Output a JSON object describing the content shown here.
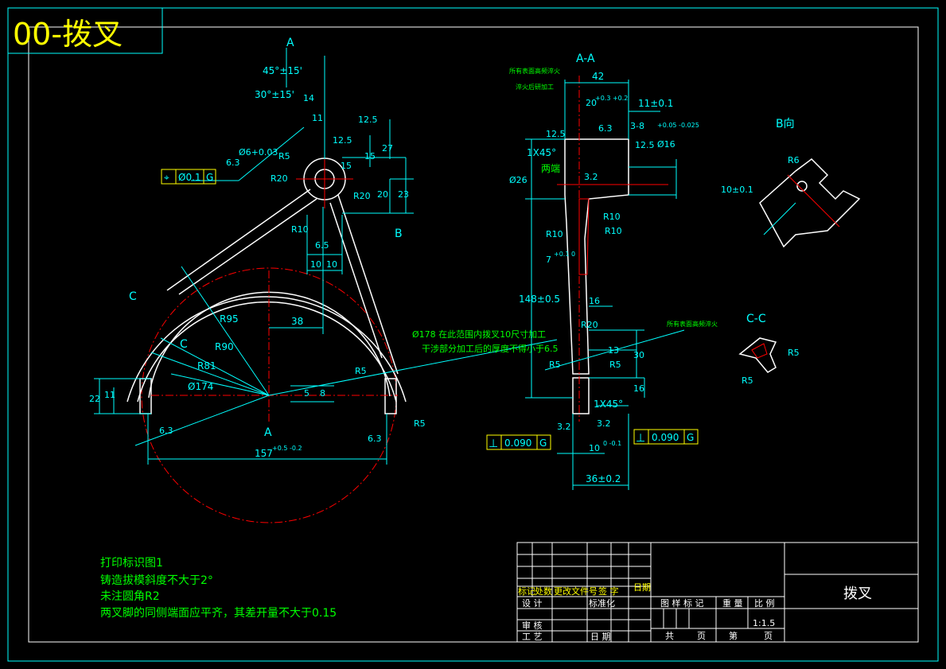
{
  "drawing_title": "00-拨叉",
  "section_labels": {
    "a_top": "A",
    "a_bottom": "A",
    "b_arrow": "B",
    "c_left": "C",
    "c_inner": "C",
    "aa_title": "A-A",
    "b_view": "B向",
    "cc_title": "C-C"
  },
  "front_view": {
    "dims": {
      "ang45": "45°±15'",
      "ang30": "30°±15'",
      "d14": "14",
      "d11": "11",
      "d12_5": "12.5",
      "d12_5b": "12.5",
      "d27": "27",
      "d15": "15",
      "d15b": "15",
      "hole": "Ø6+0.03",
      "r5": "R5",
      "r20a": "R20",
      "r20b": "R20",
      "d20": "20",
      "d23": "23",
      "r10": "R10",
      "d6_5": "6.5",
      "d10a": "10",
      "d10b": "10",
      "r95": "R95",
      "r90": "R90",
      "r81": "R81",
      "d38": "38",
      "phi174": "Ø174",
      "r5b": "R5",
      "r5c": "R5",
      "d22": "22",
      "d11b": "11",
      "d5": "5",
      "d8": "8",
      "d157": "157",
      "tol157": "+0.5 -0.2",
      "rough63a": "6.3",
      "rough63b": "6.3",
      "rough63c": "6.3",
      "phi178": "Ø178 在此范围内拨叉10尺寸加工",
      "note_dry": "干涉部分加工后的厚度不得小于6.5"
    },
    "tolerance_frame": {
      "symbol": "⌖",
      "value": "Ø0.1",
      "datum": "G"
    }
  },
  "section_view": {
    "notes": {
      "n1": "所有表面高频淬火",
      "n2": "淬火后研加工"
    },
    "dims": {
      "d42": "42",
      "d20": "20",
      "tol20": "+0.3 +0.2",
      "d11": "11±0.1",
      "d6_3": "6.3",
      "d3_8": "3-8",
      "phi16": "Ø16",
      "tol16": "+0.05 -0.025",
      "r12_5a": "12.5",
      "r12_5b": "12.5",
      "chamfer": "1X45°",
      "both_ends": "两端",
      "phi26": "Ø26",
      "d3_2": "3.2",
      "r10a": "R10",
      "r10b": "R10",
      "r10c": "R10",
      "d7": "7",
      "tol7": "+0.1 0",
      "d148": "148±0.5",
      "d16": "16",
      "r20": "R20",
      "d13": "13",
      "d30": "30",
      "r5a": "R5",
      "r5b": "R5",
      "d16b": "16",
      "chamfer2": "1X45°",
      "d3_2b": "3.2",
      "d3_2c": "3.2",
      "d10": "10",
      "tol10": "0 -0.1",
      "d36": "36±0.2"
    },
    "notes2": {
      "n3": "所有表面高频淬火"
    },
    "perp_left": {
      "symbol": "⊥",
      "value": "0.090",
      "datum": "G"
    },
    "perp_right": {
      "symbol": "⊥",
      "value": "0.090",
      "datum": "G"
    }
  },
  "b_view": {
    "r6": "R6",
    "d10": "10±0.1"
  },
  "cc_view": {
    "r5a": "R5",
    "r5b": "R5"
  },
  "tech_notes": [
    "打印标识图1",
    "铸造拔模斜度不大于2°",
    "未注圆角R2",
    "两叉脚的同侧端面应平齐，其差开量不大于0.15"
  ],
  "title_block": {
    "part_name": "拨叉",
    "scale": "1:1.5",
    "headers": {
      "mark": "标记",
      "count": "处数",
      "change_doc": "更改文件号",
      "signature": "签 字",
      "date": "日期",
      "design": "设 计",
      "standardize": "标准化",
      "review": "审 核",
      "process": "工 艺",
      "date2": "日 期",
      "stage_mark": "图 样 标 记",
      "weight": "重 量",
      "ratio": "比 例",
      "total": "共",
      "page": "页",
      "sheet": "第",
      "page2": "页"
    }
  },
  "colors": {
    "outline": "#ffffff",
    "dimension": "#00ffff",
    "centerline": "#ff0000",
    "note_text": "#00ff00",
    "title_text": "#ffff00",
    "frame": "#00ffff"
  }
}
